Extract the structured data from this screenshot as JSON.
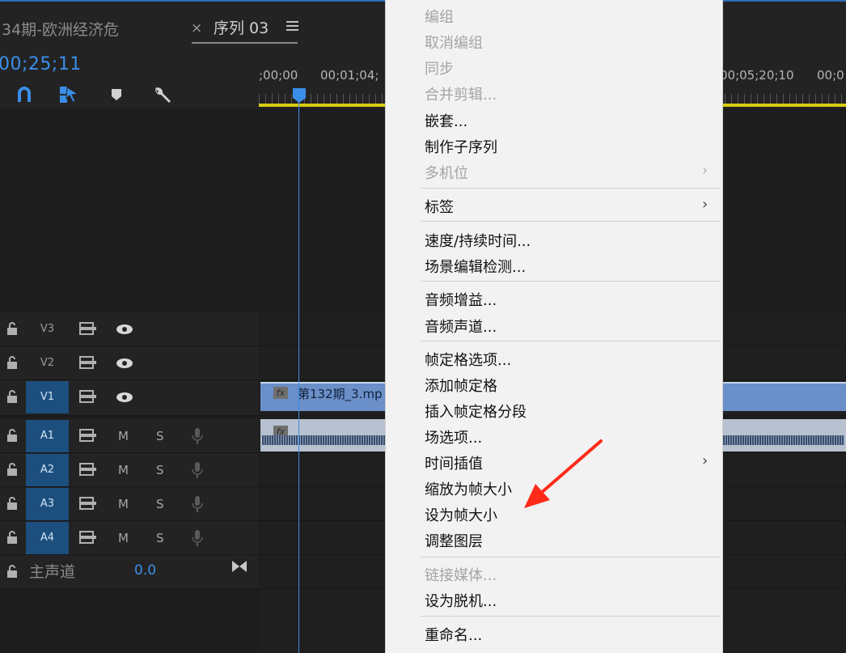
{
  "header": {
    "tab_inactive": "34期-欧洲经济危",
    "tab_close": "×",
    "tab_active": "序列 03"
  },
  "timecode": "00;25;11",
  "ruler": {
    "labels": [
      ";00;00",
      "00;01;04;",
      "00;05;20;10",
      "00;0"
    ]
  },
  "tracks": {
    "video": [
      {
        "name": "V3",
        "active": false
      },
      {
        "name": "V2",
        "active": false
      },
      {
        "name": "V1",
        "active": true
      }
    ],
    "audio": [
      {
        "name": "A1",
        "m": "M",
        "s": "S"
      },
      {
        "name": "A2",
        "m": "M",
        "s": "S"
      },
      {
        "name": "A3",
        "m": "M",
        "s": "S"
      },
      {
        "name": "A4",
        "m": "M",
        "s": "S"
      }
    ],
    "master": {
      "label": "主声道",
      "value": "0.0"
    }
  },
  "clips": {
    "video_fx": "fx",
    "video_name": "第132期_3.mp",
    "audio_fx": "fx"
  },
  "context_menu": {
    "items": [
      {
        "label": "编组",
        "disabled": true
      },
      {
        "label": "取消编组",
        "disabled": true
      },
      {
        "label": "同步",
        "disabled": true
      },
      {
        "label": "合并剪辑...",
        "disabled": true
      },
      {
        "label": "嵌套...",
        "disabled": false
      },
      {
        "label": "制作子序列",
        "disabled": false
      },
      {
        "label": "多机位",
        "disabled": true,
        "submenu": true
      },
      {
        "label": "标签",
        "disabled": false,
        "submenu": true
      },
      {
        "label": "速度/持续时间...",
        "disabled": false
      },
      {
        "label": "场景编辑检测...",
        "disabled": false
      },
      {
        "label": "音频增益...",
        "disabled": false
      },
      {
        "label": "音频声道...",
        "disabled": false
      },
      {
        "label": "帧定格选项...",
        "disabled": false
      },
      {
        "label": "添加帧定格",
        "disabled": false
      },
      {
        "label": "插入帧定格分段",
        "disabled": false
      },
      {
        "label": "场选项...",
        "disabled": false
      },
      {
        "label": "时间插值",
        "disabled": false,
        "submenu": true
      },
      {
        "label": "缩放为帧大小",
        "disabled": false
      },
      {
        "label": "设为帧大小",
        "disabled": false
      },
      {
        "label": "调整图层",
        "disabled": false
      },
      {
        "label": "链接媒体...",
        "disabled": true
      },
      {
        "label": "设为脱机...",
        "disabled": false
      },
      {
        "label": "重命名...",
        "disabled": false
      }
    ],
    "submenu_glyph": "›"
  },
  "colors": {
    "accent": "#3b8ee8",
    "highlight_arrow": "#ff2a1a",
    "clip_video": "#6b8fc8",
    "ruler_yellow": "#d8cc12"
  },
  "icons": [
    "snap-magnet-icon",
    "linked-selection-icon",
    "add-marker-icon",
    "wrench-icon",
    "lock-icon",
    "track-output-icon",
    "eye-icon",
    "microphone-icon",
    "master-bowtie-icon",
    "hamburger-menu-icon"
  ]
}
